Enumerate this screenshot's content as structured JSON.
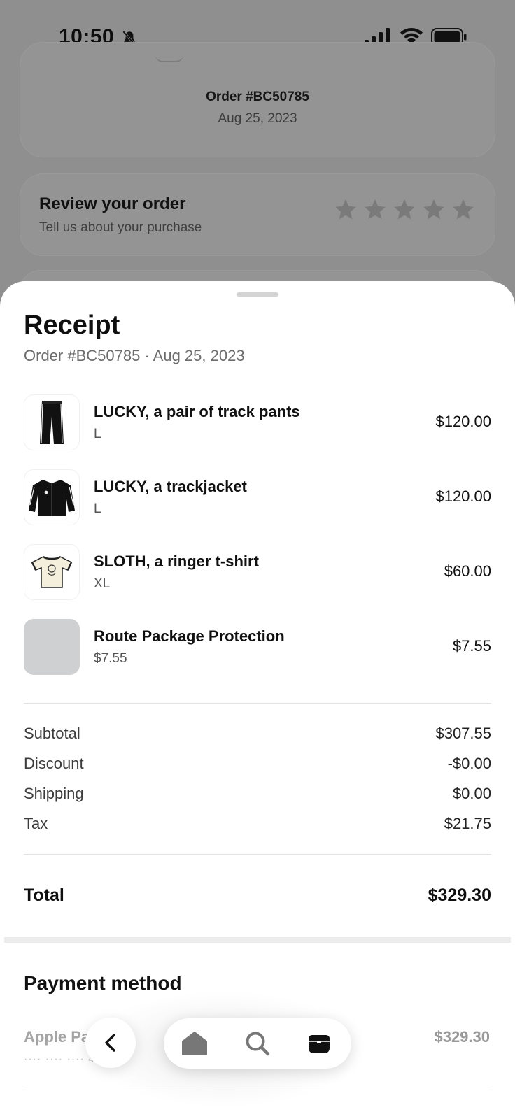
{
  "status_bar": {
    "time": "10:50"
  },
  "background": {
    "order_card": {
      "order_number": "Order #BC50785",
      "date": "Aug 25, 2023"
    },
    "review_card": {
      "title": "Review your order",
      "subtitle": "Tell us about your purchase",
      "star_count": 5
    }
  },
  "receipt": {
    "title": "Receipt",
    "subtitle": "Order #BC50785 · Aug 25, 2023",
    "items": [
      {
        "name": "LUCKY, a pair of track pants",
        "variant": "L",
        "price": "$120.00",
        "thumb": "track-pants-icon"
      },
      {
        "name": "LUCKY, a trackjacket",
        "variant": "L",
        "price": "$120.00",
        "thumb": "track-jacket-icon"
      },
      {
        "name": "SLOTH, a ringer t-shirt",
        "variant": "XL",
        "price": "$60.00",
        "thumb": "ringer-tshirt-icon"
      },
      {
        "name": "Route Package Protection",
        "variant": "$7.55",
        "price": "$7.55",
        "thumb": "placeholder"
      }
    ],
    "summary": [
      {
        "label": "Subtotal",
        "value": "$307.55"
      },
      {
        "label": "Discount",
        "value": "-$0.00"
      },
      {
        "label": "Shipping",
        "value": "$0.00"
      },
      {
        "label": "Tax",
        "value": "$21.75"
      }
    ],
    "total": {
      "label": "Total",
      "value": "$329.30"
    }
  },
  "payment": {
    "title": "Payment method",
    "method_name": "Apple Pa",
    "card_mask": "···· ···· ···· 451",
    "amount": "$329.30"
  },
  "nav": {
    "items": [
      "back-icon",
      "home-icon",
      "search-icon",
      "orders-box-icon"
    ]
  },
  "colors": {
    "sheet_bg": "#ffffff",
    "dim_bg": "#8f8f8f",
    "placeholder_thumb": "#cfd0d2"
  }
}
